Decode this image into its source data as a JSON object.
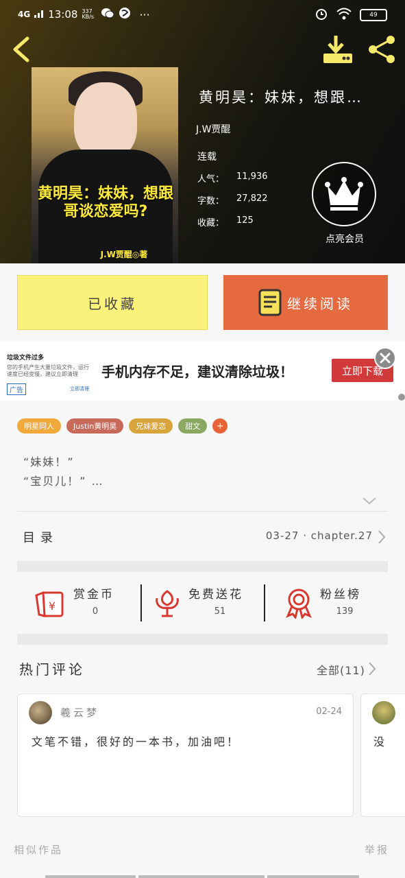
{
  "status_bar": {
    "network": "4G",
    "time": "13:08",
    "speed_value": "337",
    "speed_unit": "KB/s",
    "more": "···",
    "battery": "49"
  },
  "book": {
    "title": "黄明昊：妹妹，想跟…",
    "author": "J.W贾醌",
    "status": "连载",
    "popularity_label": "人气：",
    "popularity": "11,936",
    "words_label": "字数：",
    "words": "27,822",
    "favorites_label": "收藏：",
    "favorites": "125",
    "cover_title": "黄明昊：妹妹，想跟哥谈恋爱吗?",
    "cover_author": "J.W贾醌◎著"
  },
  "vip": {
    "label": "点亮会员"
  },
  "actions": {
    "favorited_label": "已收藏",
    "continue_label": "继续阅读"
  },
  "ad": {
    "thumb_title": "垃圾文件过多",
    "thumb_desc": "您的手机产生大量垃圾文件，运行速度已经变慢，建议立即清理",
    "thumb_tag": "广告",
    "thumb_link": "立即清理",
    "headline": "手机内存不足，建议清除垃圾！",
    "cta": "立即下载"
  },
  "tags": [
    {
      "label": "明星同人",
      "color": "#f0a93a"
    },
    {
      "label": "Justin黄明昊",
      "color": "#c86a5a"
    },
    {
      "label": "兄妹爱恋",
      "color": "#d8a43c"
    },
    {
      "label": "甜文",
      "color": "#8aa862"
    }
  ],
  "tag_more": "+",
  "intro": {
    "line1": "“妹妹！”",
    "line2": "“宝贝儿！” …"
  },
  "toc": {
    "label": "目录",
    "latest": "03-27 · chapter.27"
  },
  "engagement": {
    "reward": {
      "label": "赏金币",
      "count": "0"
    },
    "flower": {
      "label": "免费送花",
      "count": "51"
    },
    "fans": {
      "label": "粉丝榜",
      "count": "139"
    }
  },
  "comments": {
    "section_title": "热门评论",
    "all_label": "全部(11)",
    "items": [
      {
        "user": "羲云梦",
        "date": "02-24",
        "text": "文笔不错，很好的一本书，加油吧！"
      },
      {
        "text": "没"
      }
    ]
  },
  "footer": {
    "similar": "相似作品",
    "report": "举报"
  },
  "colors": {
    "accent": "#e66a40",
    "fav_button": "#fbf27c",
    "icon_red": "#d8392f",
    "header_icon_yellow": "#f7e96a"
  }
}
